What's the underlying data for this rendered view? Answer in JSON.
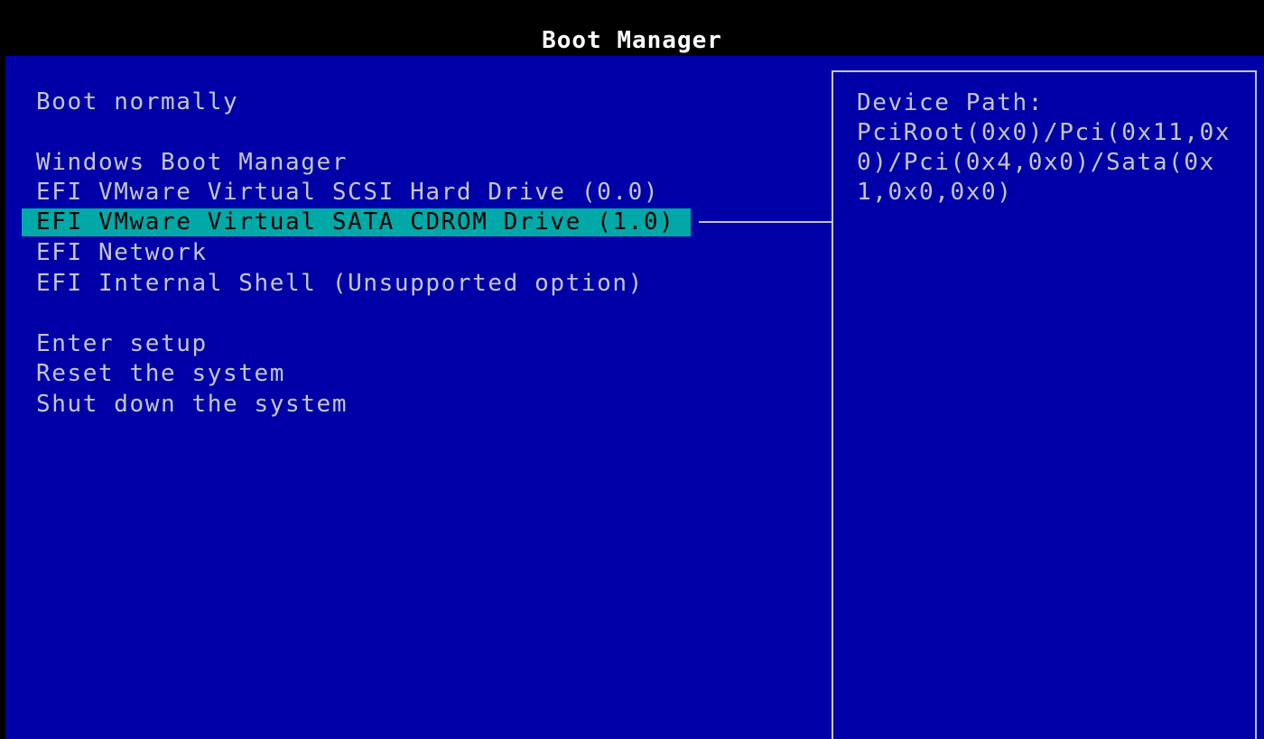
{
  "header": {
    "title": "Boot Manager"
  },
  "menu": {
    "items": [
      {
        "label": "Boot normally"
      },
      {
        "label": "Windows Boot Manager"
      },
      {
        "label": "EFI VMware Virtual SCSI Hard Drive (0.0)"
      },
      {
        "label": "EFI VMware Virtual SATA CDROM Drive (1.0)",
        "selected": true
      },
      {
        "label": "EFI Network"
      },
      {
        "label": "EFI Internal Shell (Unsupported option)"
      },
      {
        "label": "Enter setup"
      },
      {
        "label": "Reset the system"
      },
      {
        "label": "Shut down the system"
      }
    ]
  },
  "info_panel": {
    "label": "Device Path:",
    "value": "PciRoot(0x0)/Pci(0x11,0x0)/Pci(0x4,0x0)/Sata(0x1,0x0,0x0)"
  },
  "colors": {
    "background": "#0000a8",
    "text": "#c6c6c6",
    "highlight": "#00a8a8",
    "title_bar": "#000000",
    "title_text": "#ffffff"
  }
}
